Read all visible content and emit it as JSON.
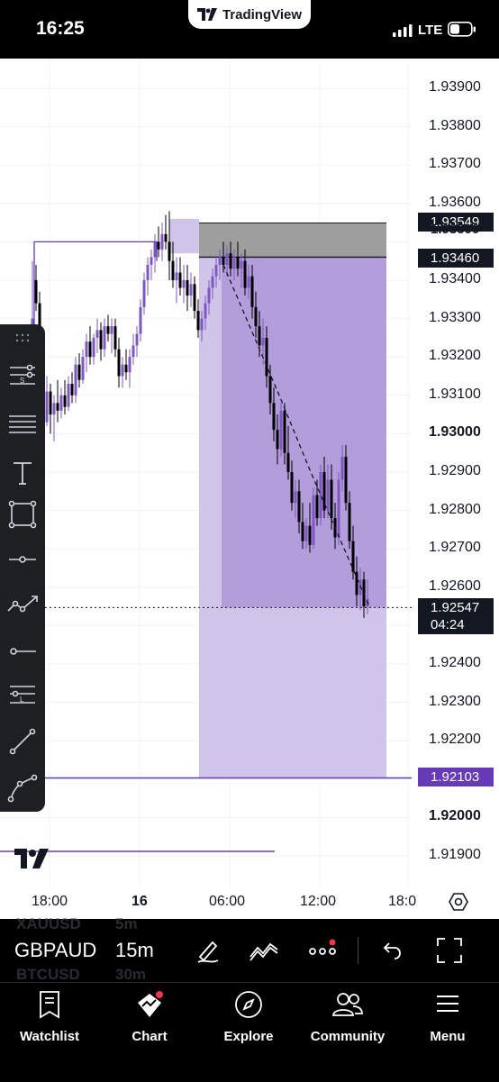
{
  "status_bar": {
    "time": "16:25",
    "brand": "TradingView",
    "network": "LTE"
  },
  "chart": {
    "price_levels": [
      "1.93900",
      "1.93800",
      "1.93700",
      "1.93600",
      "1.93500",
      "1.93400",
      "1.93300",
      "1.93200",
      "1.93100",
      "1.93000",
      "1.92900",
      "1.92800",
      "1.92700",
      "1.92600",
      "1.92400",
      "1.92300",
      "1.92200",
      "1.92000",
      "1.91900"
    ],
    "time_labels": [
      "18:00",
      "16",
      "06:00",
      "12:00",
      "18:0"
    ],
    "tags": {
      "target_price": "1.93549",
      "entry_price": "1.93460",
      "current_price": "1.92547",
      "countdown": "04:24",
      "stop_price": "1.92103"
    },
    "colors": {
      "bar_up": "#7e57c2",
      "bar_down": "#000000",
      "zone": "#b39ddb",
      "zone_light": "#d1c4e9",
      "stop_line": "#673ab7",
      "target_zone": "#9e9e9e"
    }
  },
  "chart_data": {
    "type": "candlestick",
    "y_unit": "price",
    "ylim": [
      1.9185,
      1.9396
    ],
    "x_labels": [
      "18:00",
      "16",
      "06:00",
      "12:00",
      "18:0"
    ],
    "horizontal_levels": {
      "target": 1.93549,
      "entry": 1.9346,
      "current": 1.92547,
      "stop": 1.92103
    }
  },
  "toolbar": {
    "tools": [
      "drag-handle-icon",
      "horizontal-ray-s-icon",
      "multi-line-icon",
      "text-tool-icon",
      "rectangle-tool-icon",
      "horizontal-line-icon",
      "trend-path-icon",
      "horizontal-ray-icon",
      "horizontal-line-l-icon",
      "trend-line-icon",
      "polyline-icon"
    ]
  },
  "symbol_bar": {
    "symbol": "GBPAUD",
    "interval": "15m",
    "ghost_above_symbol": "XAUUSD",
    "ghost_above_interval": "5m",
    "ghost_below_symbol": "BTCUSD",
    "ghost_below_interval": "30m"
  },
  "nav": {
    "items": [
      {
        "label": "Watchlist",
        "icon": "watchlist-icon"
      },
      {
        "label": "Chart",
        "icon": "chart-icon"
      },
      {
        "label": "Explore",
        "icon": "compass-icon"
      },
      {
        "label": "Community",
        "icon": "community-icon"
      },
      {
        "label": "Menu",
        "icon": "menu-icon"
      }
    ]
  }
}
